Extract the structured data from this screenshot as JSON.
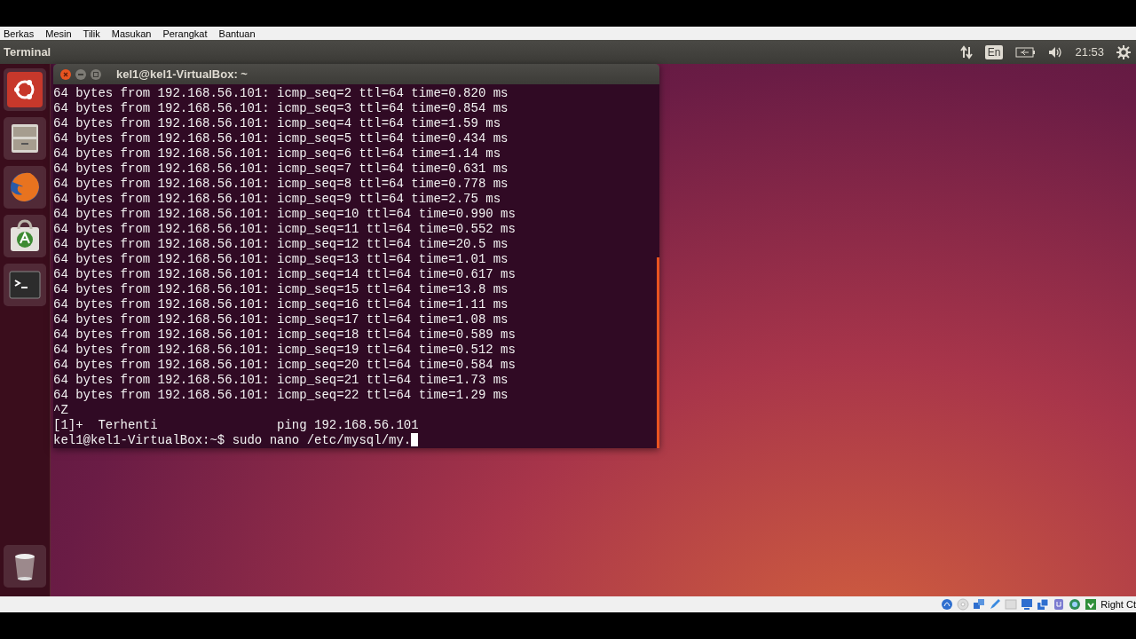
{
  "host_menu": [
    "Berkas",
    "Mesin",
    "Tilik",
    "Masukan",
    "Perangkat",
    "Bantuan"
  ],
  "top_panel": {
    "app_title": "Terminal",
    "keyboard_layout": "En",
    "clock": "21:53"
  },
  "launcher": [
    {
      "kind": "dash"
    },
    {
      "kind": "files"
    },
    {
      "kind": "browser"
    },
    {
      "kind": "software"
    },
    {
      "kind": "terminal"
    },
    {
      "kind": "trash"
    }
  ],
  "terminal": {
    "title": "kel1@kel1-VirtualBox: ~",
    "lines": [
      "64 bytes from 192.168.56.101: icmp_seq=2 ttl=64 time=0.820 ms",
      "64 bytes from 192.168.56.101: icmp_seq=3 ttl=64 time=0.854 ms",
      "64 bytes from 192.168.56.101: icmp_seq=4 ttl=64 time=1.59 ms",
      "64 bytes from 192.168.56.101: icmp_seq=5 ttl=64 time=0.434 ms",
      "64 bytes from 192.168.56.101: icmp_seq=6 ttl=64 time=1.14 ms",
      "64 bytes from 192.168.56.101: icmp_seq=7 ttl=64 time=0.631 ms",
      "64 bytes from 192.168.56.101: icmp_seq=8 ttl=64 time=0.778 ms",
      "64 bytes from 192.168.56.101: icmp_seq=9 ttl=64 time=2.75 ms",
      "64 bytes from 192.168.56.101: icmp_seq=10 ttl=64 time=0.990 ms",
      "64 bytes from 192.168.56.101: icmp_seq=11 ttl=64 time=0.552 ms",
      "64 bytes from 192.168.56.101: icmp_seq=12 ttl=64 time=20.5 ms",
      "64 bytes from 192.168.56.101: icmp_seq=13 ttl=64 time=1.01 ms",
      "64 bytes from 192.168.56.101: icmp_seq=14 ttl=64 time=0.617 ms",
      "64 bytes from 192.168.56.101: icmp_seq=15 ttl=64 time=13.8 ms",
      "64 bytes from 192.168.56.101: icmp_seq=16 ttl=64 time=1.11 ms",
      "64 bytes from 192.168.56.101: icmp_seq=17 ttl=64 time=1.08 ms",
      "64 bytes from 192.168.56.101: icmp_seq=18 ttl=64 time=0.589 ms",
      "64 bytes from 192.168.56.101: icmp_seq=19 ttl=64 time=0.512 ms",
      "64 bytes from 192.168.56.101: icmp_seq=20 ttl=64 time=0.584 ms",
      "64 bytes from 192.168.56.101: icmp_seq=21 ttl=64 time=1.73 ms",
      "64 bytes from 192.168.56.101: icmp_seq=22 ttl=64 time=1.29 ms",
      "^Z",
      "[1]+  Terhenti                ping 192.168.56.101"
    ],
    "prompt": "kel1@kel1-VirtualBox:~$ sudo nano /etc/mysql/my."
  },
  "host_status": {
    "host_key": "Right Ct"
  }
}
